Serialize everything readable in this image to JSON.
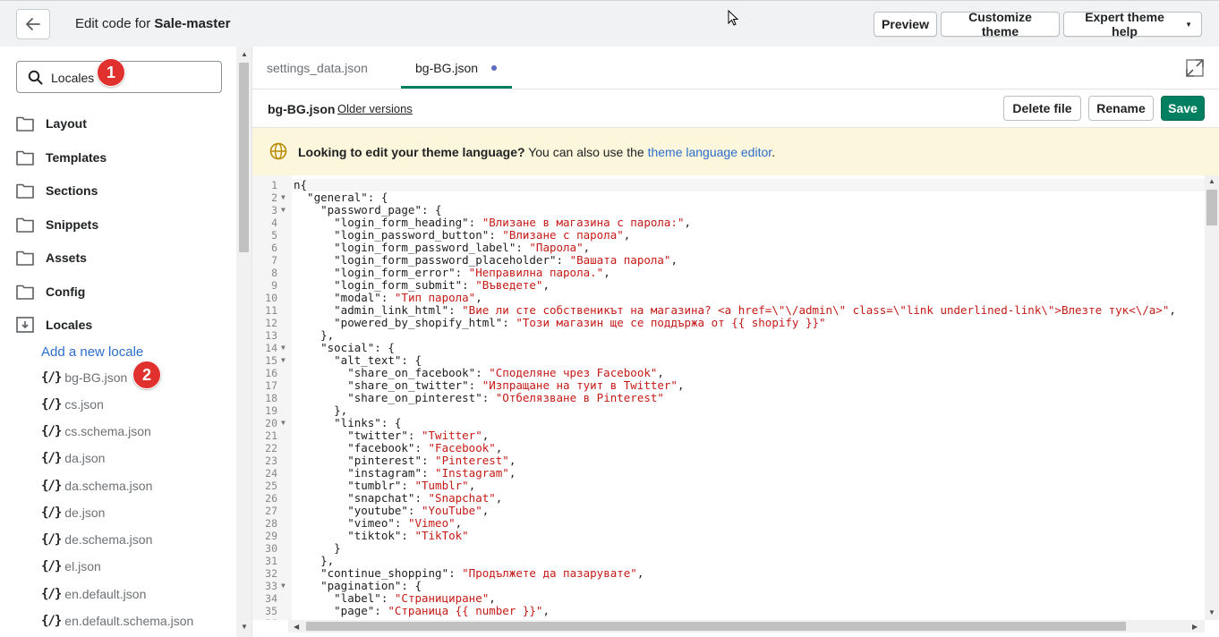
{
  "header": {
    "title_prefix": "Edit code for",
    "theme_name": "Sale-master",
    "preview_label": "Preview",
    "customize_label": "Customize theme",
    "help_label": "Expert theme help"
  },
  "sidebar": {
    "search_value": "Locales",
    "badge_1": "1",
    "badge_2": "2",
    "folders": [
      "Layout",
      "Templates",
      "Sections",
      "Snippets",
      "Assets",
      "Config",
      "Locales"
    ],
    "add_locale": "Add a new locale",
    "files": [
      "bg-BG.json",
      "cs.json",
      "cs.schema.json",
      "da.json",
      "da.schema.json",
      "de.json",
      "de.schema.json",
      "el.json",
      "en.default.json",
      "en.default.schema.json"
    ],
    "file_icon": "{/}"
  },
  "tabs": [
    "settings_data.json",
    "bg-BG.json"
  ],
  "filebar": {
    "filename": "bg-BG.json",
    "older_versions": "Older versions",
    "delete_label": "Delete file",
    "rename_label": "Rename",
    "save_label": "Save"
  },
  "banner": {
    "question": "Looking to edit your theme language?",
    "middle": " You can also use the ",
    "link": "theme language editor",
    "end": "."
  },
  "code": {
    "lines": [
      [
        [
          "k",
          "n{"
        ]
      ],
      [
        [
          "k",
          "  \"general\": {"
        ]
      ],
      [
        [
          "k",
          "    \"password_page\": {"
        ]
      ],
      [
        [
          "k",
          "      \"login_form_heading\": "
        ],
        [
          "s",
          "\"Влизане в магазина с парола:\""
        ],
        [
          "k",
          ","
        ]
      ],
      [
        [
          "k",
          "      \"login_password_button\": "
        ],
        [
          "s",
          "\"Влизане с парола\""
        ],
        [
          "k",
          ","
        ]
      ],
      [
        [
          "k",
          "      \"login_form_password_label\": "
        ],
        [
          "s",
          "\"Парола\""
        ],
        [
          "k",
          ","
        ]
      ],
      [
        [
          "k",
          "      \"login_form_password_placeholder\": "
        ],
        [
          "s",
          "\"Вашата парола\""
        ],
        [
          "k",
          ","
        ]
      ],
      [
        [
          "k",
          "      \"login_form_error\": "
        ],
        [
          "s",
          "\"Неправилна парола.\""
        ],
        [
          "k",
          ","
        ]
      ],
      [
        [
          "k",
          "      \"login_form_submit\": "
        ],
        [
          "s",
          "\"Въведете\""
        ],
        [
          "k",
          ","
        ]
      ],
      [
        [
          "k",
          "      \"modal\": "
        ],
        [
          "s",
          "\"Тип парола\""
        ],
        [
          "k",
          ","
        ]
      ],
      [
        [
          "k",
          "      \"admin_link_html\": "
        ],
        [
          "s",
          "\"Вие ли сте собственикът на магазина? <a href=\\\"\\/admin\\\" class=\\\"link underlined-link\\\">Влезте тук<\\/a>\""
        ],
        [
          "k",
          ","
        ]
      ],
      [
        [
          "k",
          "      \"powered_by_shopify_html\": "
        ],
        [
          "s",
          "\"Този магазин ще се поддържа от {{ shopify }}\""
        ]
      ],
      [
        [
          "k",
          "    },"
        ]
      ],
      [
        [
          "k",
          "    \"social\": {"
        ]
      ],
      [
        [
          "k",
          "      \"alt_text\": {"
        ]
      ],
      [
        [
          "k",
          "        \"share_on_facebook\": "
        ],
        [
          "s",
          "\"Споделяне чрез Facebook\""
        ],
        [
          "k",
          ","
        ]
      ],
      [
        [
          "k",
          "        \"share_on_twitter\": "
        ],
        [
          "s",
          "\"Изпращане на туит в Twitter\""
        ],
        [
          "k",
          ","
        ]
      ],
      [
        [
          "k",
          "        \"share_on_pinterest\": "
        ],
        [
          "s",
          "\"Отбелязване в Pinterest\""
        ]
      ],
      [
        [
          "k",
          "      },"
        ]
      ],
      [
        [
          "k",
          "      \"links\": {"
        ]
      ],
      [
        [
          "k",
          "        \"twitter\": "
        ],
        [
          "s",
          "\"Twitter\""
        ],
        [
          "k",
          ","
        ]
      ],
      [
        [
          "k",
          "        \"facebook\": "
        ],
        [
          "s",
          "\"Facebook\""
        ],
        [
          "k",
          ","
        ]
      ],
      [
        [
          "k",
          "        \"pinterest\": "
        ],
        [
          "s",
          "\"Pinterest\""
        ],
        [
          "k",
          ","
        ]
      ],
      [
        [
          "k",
          "        \"instagram\": "
        ],
        [
          "s",
          "\"Instagram\""
        ],
        [
          "k",
          ","
        ]
      ],
      [
        [
          "k",
          "        \"tumblr\": "
        ],
        [
          "s",
          "\"Tumblr\""
        ],
        [
          "k",
          ","
        ]
      ],
      [
        [
          "k",
          "        \"snapchat\": "
        ],
        [
          "s",
          "\"Snapchat\""
        ],
        [
          "k",
          ","
        ]
      ],
      [
        [
          "k",
          "        \"youtube\": "
        ],
        [
          "s",
          "\"YouTube\""
        ],
        [
          "k",
          ","
        ]
      ],
      [
        [
          "k",
          "        \"vimeo\": "
        ],
        [
          "s",
          "\"Vimeo\""
        ],
        [
          "k",
          ","
        ]
      ],
      [
        [
          "k",
          "        \"tiktok\": "
        ],
        [
          "s",
          "\"TikTok\""
        ]
      ],
      [
        [
          "k",
          "      }"
        ]
      ],
      [
        [
          "k",
          "    },"
        ]
      ],
      [
        [
          "k",
          "    \"continue_shopping\": "
        ],
        [
          "s",
          "\"Продължете да пазарувате\""
        ],
        [
          "k",
          ","
        ]
      ],
      [
        [
          "k",
          "    \"pagination\": {"
        ]
      ],
      [
        [
          "k",
          "      \"label\": "
        ],
        [
          "s",
          "\"Странициране\""
        ],
        [
          "k",
          ","
        ]
      ],
      [
        [
          "k",
          "      \"page\": "
        ],
        [
          "s",
          "\"Страница {{ number }}\""
        ],
        [
          "k",
          ","
        ]
      ],
      [
        [
          "k",
          ""
        ]
      ]
    ],
    "folded_lines": [
      2,
      3,
      14,
      15,
      20,
      33
    ]
  },
  "colors": {
    "accent": "#008060",
    "link": "#2c6ecb",
    "badge": "#e0312e",
    "banner_bg": "#fcf6dc",
    "string": "#c41a16"
  }
}
